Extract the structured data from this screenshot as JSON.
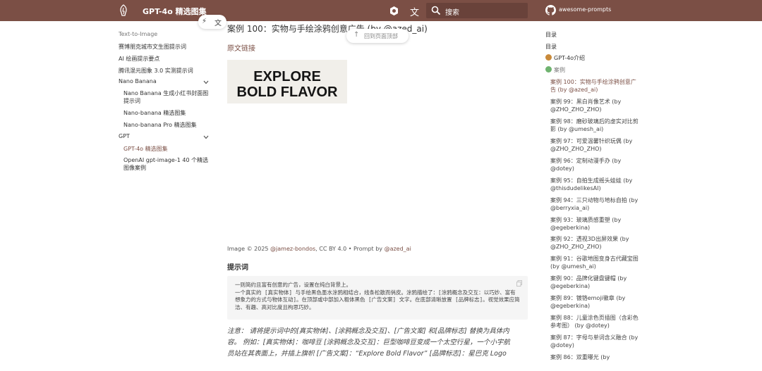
{
  "header": {
    "site_title": "GPT-4o 精选图集",
    "translate_glyph": "文",
    "search_placeholder": "搜索",
    "repo_name": "awesome-prompts",
    "bg_color": "#7b4f45"
  },
  "floating": {
    "tool1_glyph": "⚡",
    "tool2_glyph": "文",
    "back_to_top_arrow": "↑",
    "back_to_top_label": "回到页面顶部"
  },
  "leftnav": {
    "section_text_to_image": "Text-to-Image",
    "items": [
      "赛博朋克城市文生图提示词",
      "AI 绘画提示要点",
      "腾讯混元图象 3.0 实测提示词"
    ],
    "section_nano_banana": "Nano Banana",
    "nano_items": [
      "Nano Banana 生成小红书封面图提示词",
      "Nano-banana 精选图集",
      "Nano-banana Pro 精选图集"
    ],
    "section_gpt": "GPT",
    "gpt_items": [
      "GPT-4o 精选图集",
      "OpenAI gpt-image-1 40 个精选图像案例"
    ]
  },
  "main": {
    "title": "案例 100：实物与手绘涂鸦创意广告 (by @azed_ai)",
    "original_link": "原文链接",
    "image_text_line1": "EXPLORE",
    "image_text_line2": "BOLD FLAVOR",
    "credit_prefix": "Image © 2025 ",
    "credit_author": "@jamez-bondos",
    "credit_license": ", CC BY 4.0",
    "credit_mid": " • Prompt by ",
    "credit_prompt_author": "@azed_ai",
    "prompt_heading": "提示词",
    "prompt_code": "一则简约且富有创意的广告，设置在纯白背景上。\n一个真实的 [真实物体] 与手绘黑色墨水涂鸦相结合，线条松散而俏皮。涂鸦描绘了：[涂鸦概念及交互：以巧妙、富有想象力的方式与物体互动]。在顶部或中部加入粗体黑色 [广告文案] 文字。在底部清晰放置 [品牌标志]。视觉效果应简洁、有趣、高对比度且构思巧妙。",
    "note": "注意：  请将提示词中的[真实物体]、[涂鸦概念及交互]、[广告文案] 和[品牌标志] 替换为具体内容。 例如：[真实物体]：咖啡豆 [涂鸦概念及交互]：巨型咖啡豆变成一个太空行星，一个小宇航员站在其表面上，并插上旗帜 [广告文案]：“Explore Bold Flavor” [品牌标志]：星巴克 Logo"
  },
  "toc": {
    "heading1": "目录",
    "heading2": "目录",
    "group_intro": "GPT-4o介绍",
    "group_cases": "案例",
    "entries": [
      "案例 100：实物与手绘涂鸦创意广告 (by @azed_ai)",
      "案例 99：黑白肖像艺术 (by @ZHO_ZHO_ZHO)",
      "案例 98：磨砂玻璃后的虚实对比剪影 (by @umesh_ai)",
      "案例 97：可爱温馨针织玩偶 (by @ZHO_ZHO_ZHO)",
      "案例 96：定制动漫手办 (by @dotey)",
      "案例 95：自拍生成摇头娃娃 (by @thisdudelikesAI)",
      "案例 94：三只动物与地标自拍 (by @berryxia_ai)",
      "案例 93：玻璃质感重塑 (by @egeberkina)",
      "案例 92：透视3D出屏效果 (by @ZHO_ZHO_ZHO)",
      "案例 91：谷歌地图变身古代藏宝图 (by @umesh_ai)",
      "案例 90：品牌化键盘键帽 (by @egeberkina)",
      "案例 89：镀铬emoji徽章 (by @egeberkina)",
      "案例 88：儿童涂色页插图（含彩色参考图） (by @dotey)",
      "案例 87：字母与单词含义融合 (by @dotey)",
      "案例 86：双重曝光 (by"
    ]
  }
}
